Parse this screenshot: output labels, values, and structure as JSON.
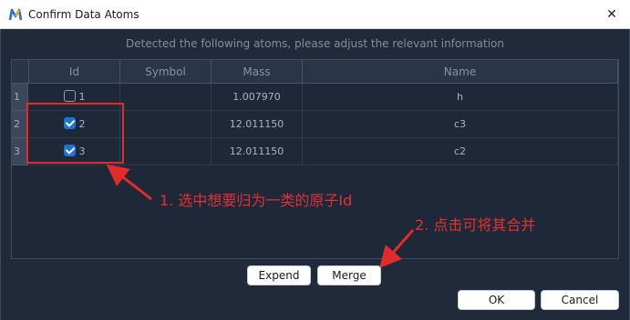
{
  "window": {
    "title": "Confirm Data Atoms",
    "close_glyph": "✕",
    "app_icon": "app-logo-icon"
  },
  "info_text": "Detected the following atoms, please adjust the relevant information",
  "table": {
    "headers": [
      "Id",
      "Symbol",
      "Mass",
      "Name"
    ],
    "rows": [
      {
        "row_num": "1",
        "checked": false,
        "id": "1",
        "symbol": "",
        "mass": "1.007970",
        "name": "h"
      },
      {
        "row_num": "2",
        "checked": true,
        "id": "2",
        "symbol": "",
        "mass": "12.011150",
        "name": "c3"
      },
      {
        "row_num": "3",
        "checked": true,
        "id": "3",
        "symbol": "",
        "mass": "12.011150",
        "name": "c2"
      }
    ]
  },
  "annotations": {
    "step1": "1. 选中想要归为一类的原子Id",
    "step2": "2. 点击可将其合并",
    "color": "#e03232"
  },
  "buttons": {
    "expand": "Expend",
    "merge": "Merge",
    "ok": "OK",
    "cancel": "Cancel"
  }
}
